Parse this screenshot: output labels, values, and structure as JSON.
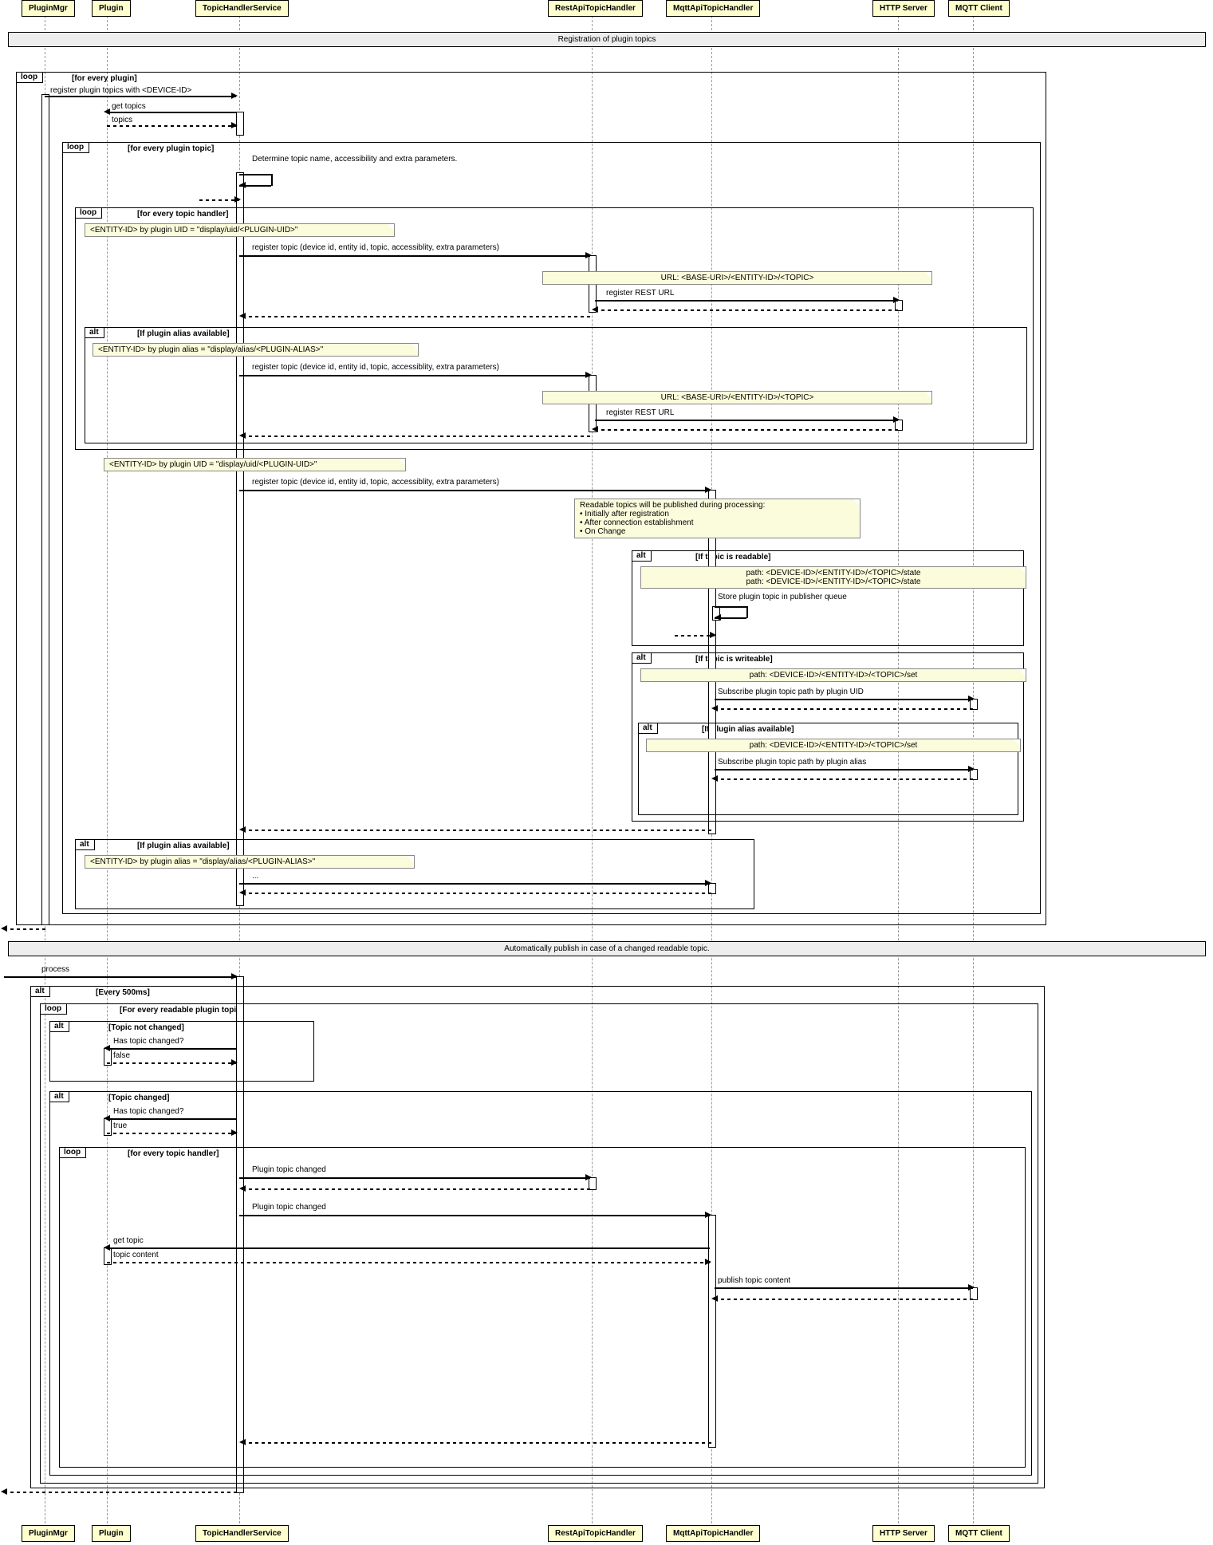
{
  "actors": [
    "PluginMgr",
    "Plugin",
    "TopicHandlerService",
    "RestApiTopicHandler",
    "MqttApiTopicHandler",
    "HTTP Server",
    "MQTT Client"
  ],
  "div1": "Registration of plugin topics",
  "div2": "Automatically publish in case of a changed readable topic.",
  "f_loop1": "loop",
  "f_loop1t": "[for every plugin]",
  "m1": "register plugin topics with <DEVICE-ID>",
  "m2": "get topics",
  "m3": "topics",
  "f_loop2": "loop",
  "f_loop2t": "[for every plugin topic]",
  "m4": "Determine topic name, accessibility and extra parameters.",
  "f_loop3": "loop",
  "f_loop3t": "[for every topic handler]",
  "n1": "<ENTITY-ID> by plugin UID = \"display/uid/<PLUGIN-UID>\"",
  "m5": "register topic (device id, entity id, topic, accessiblity, extra parameters)",
  "n2": "URL: <BASE-URI>/<ENTITY-ID>/<TOPIC>",
  "m6": "register REST URL",
  "f_alt1": "alt",
  "f_alt1t": "[If plugin alias available]",
  "n3": "<ENTITY-ID> by plugin alias = \"display/alias/<PLUGIN-ALIAS>\"",
  "n4": "<ENTITY-ID> by plugin UID = \"display/uid/<PLUGIN-UID>\"",
  "n5a": "Readable topics will be published during processing:",
  "n5b": "Initially after registration",
  "n5c": "After connection establishment",
  "n5d": "On Change",
  "f_alt2": "alt",
  "f_alt2t": "[If topic is readable]",
  "n6a": "path: <DEVICE-ID>/<ENTITY-ID>/<TOPIC>/state",
  "n6b": "path: <DEVICE-ID>/<ENTITY-ID>/<TOPIC>/state",
  "m7": "Store plugin topic in publisher queue",
  "f_alt3": "alt",
  "f_alt3t": "[If topic is writeable]",
  "n7": "path: <DEVICE-ID>/<ENTITY-ID>/<TOPIC>/set",
  "m8": "Subscribe plugin topic path by plugin UID",
  "f_alt4": "alt",
  "f_alt4t": "[If plugin alias available]",
  "n8": "path: <DEVICE-ID>/<ENTITY-ID>/<TOPIC>/set",
  "m9": "Subscribe plugin topic path by plugin alias",
  "f_alt5": "alt",
  "f_alt5t": "[If plugin alias available]",
  "n9": "<ENTITY-ID> by plugin alias = \"display/alias/<PLUGIN-ALIAS>\"",
  "m10": "...",
  "m11": "process",
  "f_alt6": "alt",
  "f_alt6t": "[Every 500ms]",
  "f_loop4": "loop",
  "f_loop4t": "[For every readable plugin topic]",
  "f_alt7": "alt",
  "f_alt7t": "[Topic not changed]",
  "m12": "Has topic changed?",
  "m13": "false",
  "f_alt7b": "alt",
  "f_alt7bt": "[Topic changed]",
  "m14": "true",
  "f_loop5": "loop",
  "f_loop5t": "[for every topic handler]",
  "m15": "Plugin topic changed",
  "m16": "Plugin topic changed",
  "m17": "get topic",
  "m18": "topic content",
  "m19": "publish topic content"
}
